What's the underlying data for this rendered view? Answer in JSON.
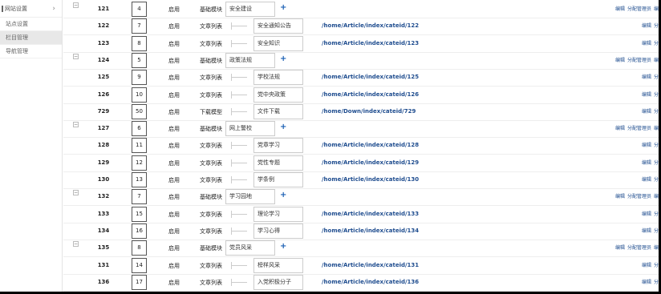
{
  "sidebar": {
    "header": "网站设置",
    "items": [
      "站点设置",
      "栏目管理",
      "导航管理"
    ]
  },
  "rows": [
    {
      "toggle": "−",
      "id": "121",
      "sort": "4",
      "status": "启用",
      "type": "基础模块",
      "name": "安全建设",
      "plus": "+",
      "url": "",
      "actions": [
        "编辑",
        "分配管理员",
        "编"
      ]
    },
    {
      "toggle": "",
      "id": "122",
      "sort": "7",
      "status": "启用",
      "type": "文章列表",
      "name": "安全通知公告",
      "plus": "",
      "url": "/home/Article/index/cateid/122",
      "actions": [
        "编辑",
        "分"
      ]
    },
    {
      "toggle": "",
      "id": "123",
      "sort": "8",
      "status": "启用",
      "type": "文章列表",
      "name": "安全知识",
      "plus": "",
      "url": "/home/Article/index/cateid/123",
      "actions": [
        "编辑",
        "分"
      ]
    },
    {
      "toggle": "−",
      "id": "124",
      "sort": "5",
      "status": "启用",
      "type": "基础模块",
      "name": "政策法规",
      "plus": "+",
      "url": "",
      "actions": [
        "编辑",
        "分配管理员",
        "编"
      ]
    },
    {
      "toggle": "",
      "id": "125",
      "sort": "9",
      "status": "启用",
      "type": "文章列表",
      "name": "学校法规",
      "plus": "",
      "url": "/home/Article/index/cateid/125",
      "actions": [
        "编辑",
        "分"
      ]
    },
    {
      "toggle": "",
      "id": "126",
      "sort": "10",
      "status": "启用",
      "type": "文章列表",
      "name": "党中央政策",
      "plus": "",
      "url": "/home/Article/index/cateid/126",
      "actions": [
        "编辑",
        "分"
      ]
    },
    {
      "toggle": "",
      "id": "729",
      "sort": "50",
      "status": "启用",
      "type": "下载模型",
      "name": "文件下载",
      "plus": "",
      "url": "/home/Down/index/cateid/729",
      "actions": [
        "编辑",
        "分"
      ]
    },
    {
      "toggle": "−",
      "id": "127",
      "sort": "6",
      "status": "启用",
      "type": "基础模块",
      "name": "网上警校",
      "plus": "+",
      "url": "",
      "actions": [
        "编辑",
        "分配管理员",
        "编"
      ]
    },
    {
      "toggle": "",
      "id": "128",
      "sort": "11",
      "status": "启用",
      "type": "文章列表",
      "name": "党章学习",
      "plus": "",
      "url": "/home/Article/index/cateid/128",
      "actions": [
        "编辑",
        "分"
      ]
    },
    {
      "toggle": "",
      "id": "129",
      "sort": "12",
      "status": "启用",
      "type": "文章列表",
      "name": "党性专题",
      "plus": "",
      "url": "/home/Article/index/cateid/129",
      "actions": [
        "编辑",
        "分"
      ]
    },
    {
      "toggle": "",
      "id": "130",
      "sort": "13",
      "status": "启用",
      "type": "文章列表",
      "name": "学条例",
      "plus": "",
      "url": "/home/Article/index/cateid/130",
      "actions": [
        "编辑",
        "分"
      ]
    },
    {
      "toggle": "−",
      "id": "132",
      "sort": "7",
      "status": "启用",
      "type": "基础模块",
      "name": "学习园地",
      "plus": "+",
      "url": "",
      "actions": [
        "编辑",
        "分配管理员",
        "编"
      ]
    },
    {
      "toggle": "",
      "id": "133",
      "sort": "15",
      "status": "启用",
      "type": "文章列表",
      "name": "理论学习",
      "plus": "",
      "url": "/home/Article/index/cateid/133",
      "actions": [
        "编辑",
        "分"
      ]
    },
    {
      "toggle": "",
      "id": "134",
      "sort": "16",
      "status": "启用",
      "type": "文章列表",
      "name": "学习心得",
      "plus": "",
      "url": "/home/Article/index/cateid/134",
      "actions": [
        "编辑",
        "分"
      ]
    },
    {
      "toggle": "−",
      "id": "135",
      "sort": "8",
      "status": "启用",
      "type": "基础模块",
      "name": "党员风采",
      "plus": "+",
      "url": "",
      "actions": [
        "编辑",
        "分配管理员",
        "编"
      ]
    },
    {
      "toggle": "",
      "id": "131",
      "sort": "14",
      "status": "启用",
      "type": "文章列表",
      "name": "榜样风采",
      "plus": "",
      "url": "/home/Article/index/cateid/131",
      "actions": [
        "编辑",
        "分"
      ]
    },
    {
      "toggle": "",
      "id": "136",
      "sort": "17",
      "status": "启用",
      "type": "文章列表",
      "name": "入党积极分子",
      "plus": "",
      "url": "/home/Article/index/cateid/136",
      "actions": [
        "编辑",
        "分"
      ]
    }
  ]
}
